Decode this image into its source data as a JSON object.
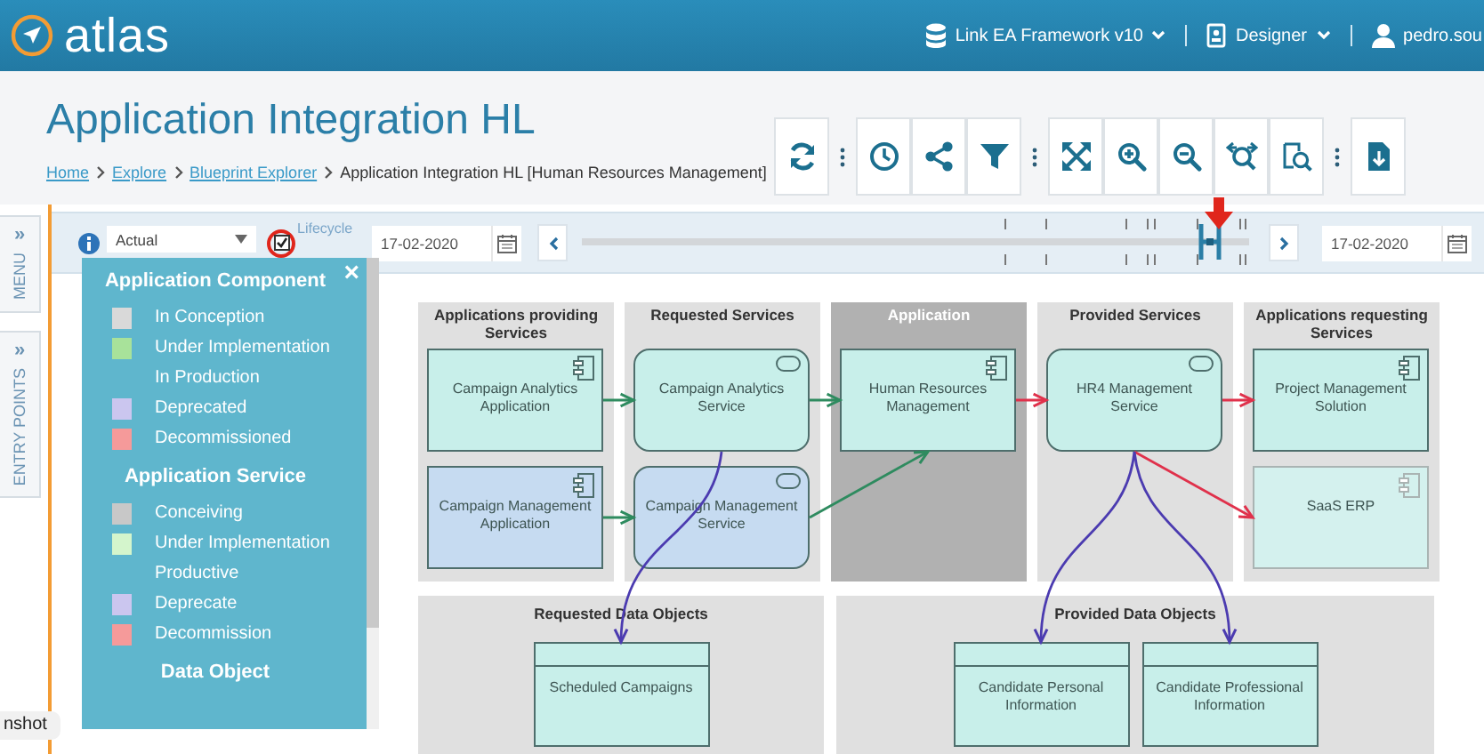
{
  "top_bar": {
    "logo": "atlas",
    "repository": "Link EA Framework v10",
    "role": "Designer",
    "user": "pedro.sou"
  },
  "page": {
    "title": "Application Integration HL",
    "breadcrumb": [
      {
        "label": "Home",
        "link": true
      },
      {
        "label": "Explore",
        "link": true
      },
      {
        "label": "Blueprint Explorer",
        "link": true
      },
      {
        "label": "Application Integration HL [Human Resources Management]",
        "link": false
      }
    ]
  },
  "side_tabs": [
    {
      "label": "MENU",
      "chevron": "»"
    },
    {
      "label": "ENTRY POINTS",
      "chevron": "»"
    }
  ],
  "filter": {
    "view": "Actual",
    "lifecycle_checked": true,
    "lifecycle_label": "Lifecycle",
    "start_date": "17-02-2020",
    "end_date": "17-02-2020",
    "timeline": {
      "level": 0.93
    }
  },
  "legend": {
    "close": "×",
    "sections": [
      {
        "title": "Application Component",
        "items": [
          {
            "label": "In Conception",
            "color": "#d9d9d9"
          },
          {
            "label": "Under Implementation",
            "color": "#a8e29a"
          },
          {
            "label": "In Production"
          },
          {
            "label": "Deprecated",
            "color": "#cbc6ef"
          },
          {
            "label": "Decommissioned",
            "color": "#f59a9a"
          }
        ]
      },
      {
        "title": "Application Service",
        "items": [
          {
            "label": "Conceiving",
            "color": "#c8c8c8"
          },
          {
            "label": "Under Implementation",
            "color": "#d4f5cc"
          },
          {
            "label": "Productive"
          },
          {
            "label": "Deprecate",
            "color": "#cbc6ef"
          },
          {
            "label": "Decommission",
            "color": "#f59a9a"
          }
        ]
      },
      {
        "title": "Data Object"
      }
    ]
  },
  "diagram": {
    "lanes": [
      {
        "title": "Applications providing Services",
        "shaded": false,
        "nodes": [
          {
            "label": "Campaign Analytics Application",
            "kind": "component",
            "color": "#c8efea",
            "faded": false
          },
          {
            "label": "Campaign Management Application",
            "kind": "component",
            "color": "#c6dbf1",
            "faded": false
          }
        ]
      },
      {
        "title": "Requested Services",
        "shaded": false,
        "nodes": [
          {
            "label": "Campaign Analytics Service",
            "kind": "service",
            "color": "#c8efea",
            "faded": false
          },
          {
            "label": "Campaign Management Service",
            "kind": "service",
            "color": "#c6dbf1",
            "faded": false
          }
        ]
      },
      {
        "title": "Application",
        "shaded": true,
        "nodes": [
          {
            "label": "Human Resources Management",
            "kind": "component",
            "color": "#c8efea",
            "faded": false
          }
        ]
      },
      {
        "title": "Provided Services",
        "shaded": false,
        "nodes": [
          {
            "label": "HR4 Management Service",
            "kind": "service",
            "color": "#c8efea",
            "faded": false
          }
        ]
      },
      {
        "title": "Applications requesting Services",
        "shaded": false,
        "nodes": [
          {
            "label": "Project Management Solution",
            "kind": "component",
            "color": "#c8efea",
            "faded": false
          },
          {
            "label": "SaaS ERP",
            "kind": "component",
            "color": "#d4f1ee",
            "faded": true
          }
        ]
      }
    ],
    "data_lanes": [
      {
        "title": "Requested Data Objects",
        "nodes": [
          {
            "label": "Scheduled Campaigns",
            "kind": "data",
            "color": "#c8efea",
            "faded": false
          }
        ]
      },
      {
        "title": "Provided Data Objects",
        "nodes": [
          {
            "label": "Candidate Personal Information",
            "kind": "data",
            "color": "#c8efea",
            "faded": false
          },
          {
            "label": "Candidate Professional Information",
            "kind": "data",
            "color": "#c8efea",
            "faded": false
          }
        ]
      }
    ]
  },
  "tooltip": "nshot"
}
